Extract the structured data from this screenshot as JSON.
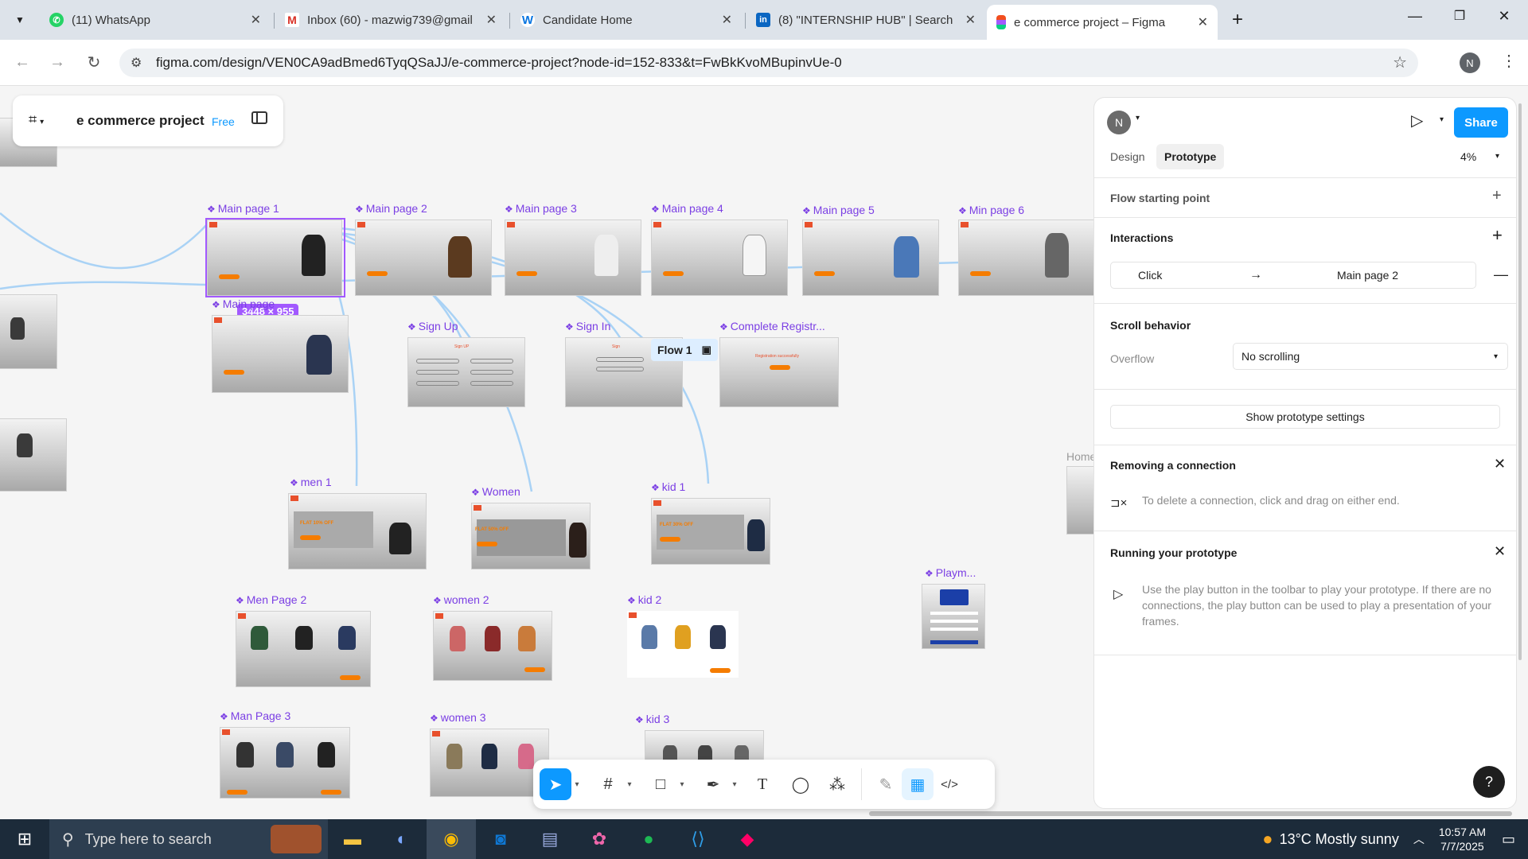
{
  "browser": {
    "tabs": [
      {
        "title": "(11) WhatsApp",
        "icon": "whatsapp-icon",
        "color": "#25d366"
      },
      {
        "title": "Inbox (60) - mazwig739@gmail",
        "icon": "gmail-icon",
        "color": "#d93025"
      },
      {
        "title": "Candidate Home",
        "icon": "workday-icon",
        "color": "#0875e1"
      },
      {
        "title": "(8) \"INTERNSHIP HUB\" | Search",
        "icon": "linkedin-icon",
        "color": "#0a66c2"
      },
      {
        "title": "e commerce project – Figma",
        "icon": "figma-icon",
        "color": "#f24e1e"
      }
    ],
    "url": "figma.com/design/VEN0CA9adBmed6TyqQSaJJ/e-commerce-project?node-id=152-833&t=FwBkKvoMBupinvUe-0",
    "profile_initial": "N"
  },
  "file": {
    "name": "e commerce project",
    "plan": "Free"
  },
  "canvas": {
    "frames": [
      {
        "label": "Main page 1"
      },
      {
        "label": "Main page  2"
      },
      {
        "label": "Main page  3"
      },
      {
        "label": "Main page  4"
      },
      {
        "label": "Main page  5"
      },
      {
        "label": "Min page 6"
      },
      {
        "label": "Main page"
      },
      {
        "label": "Sign Up"
      },
      {
        "label": "Sign In"
      },
      {
        "label": "Complete Registr..."
      },
      {
        "label": "men 1"
      },
      {
        "label": "Women"
      },
      {
        "label": "kid 1"
      },
      {
        "label": "Men Page 2"
      },
      {
        "label": "women 2"
      },
      {
        "label": "kid 2"
      },
      {
        "label": "Man Page 3"
      },
      {
        "label": "women 3"
      },
      {
        "label": "kid 3"
      },
      {
        "label": "Playm..."
      },
      {
        "label": "Home"
      }
    ],
    "flow_label": "Flow 1",
    "size_badge": "3448 × 955",
    "banner_text": {
      "flat_men": "FLAT 10% OFF",
      "flat_women": "FLAT 50% OFF",
      "flat_kid": "FLAT 30% OFF",
      "registration": "Registration successfully",
      "signup": "Sign UP",
      "signin": "Sign"
    }
  },
  "panel": {
    "avatar": "N",
    "share_label": "Share",
    "tabs": [
      "Design",
      "Prototype"
    ],
    "active_tab": "Prototype",
    "zoom": "4%",
    "flow_starting_point": "Flow starting point",
    "interactions_title": "Interactions",
    "interaction": {
      "trigger": "Click",
      "target": "Main page 2"
    },
    "scroll_title": "Scroll behavior",
    "overflow_label": "Overflow",
    "overflow_value": "No scrolling",
    "proto_settings": "Show prototype settings",
    "removing_title": "Removing a connection",
    "removing_text": "To delete a connection, click and drag on either end.",
    "running_title": "Running your prototype",
    "running_text": "Use the play button in the toolbar to play your prototype. If there are no connections, the play button can be used to play a presentation of your frames.",
    "help": "?"
  },
  "taskbar": {
    "search_placeholder": "Type here to search",
    "weather": "13°C  Mostly sunny",
    "time": "10:57 AM",
    "date": "7/7/2025"
  },
  "colors": {
    "accent": "#0d99ff",
    "frame_label": "#7b3fe4",
    "connection": "#a9d2f5",
    "orange": "#f57c00"
  }
}
